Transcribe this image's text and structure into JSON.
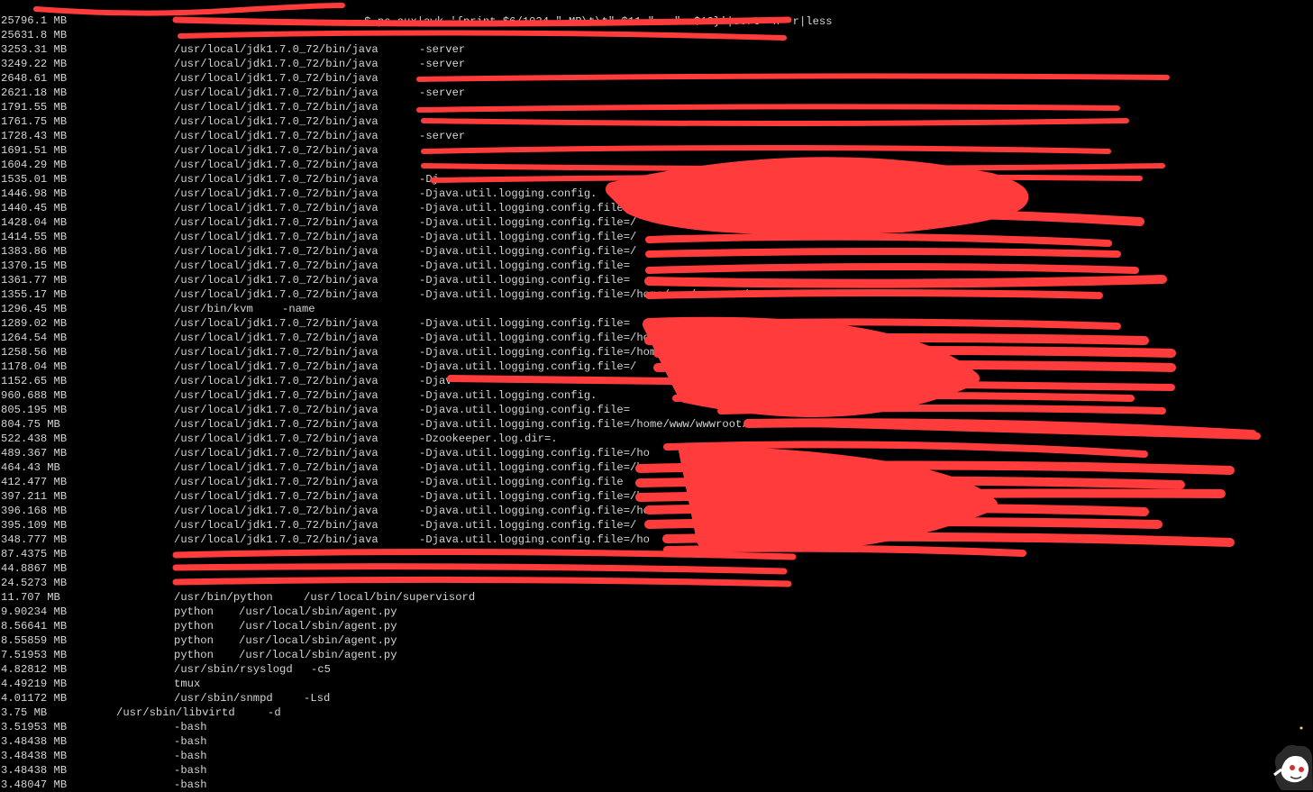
{
  "terminal": {
    "prompt_visible": "$",
    "command": " ps aux|awk '{print $6/1024 \" MB\\t\\t\" $11 \"   \"  $12}'|sort -n -r|less",
    "rows": [
      {
        "mem": "25796.1 MB",
        "bin": "",
        "arg": ""
      },
      {
        "mem": "25631.8 MB",
        "bin": "",
        "arg": ""
      },
      {
        "mem": "3253.31 MB",
        "bin": "/usr/local/jdk1.7.0_72/bin/java",
        "arg": "-server"
      },
      {
        "mem": "3249.22 MB",
        "bin": "/usr/local/jdk1.7.0_72/bin/java",
        "arg": "-server"
      },
      {
        "mem": "2648.61 MB",
        "bin": "/usr/local/jdk1.7.0_72/bin/java",
        "arg": ""
      },
      {
        "mem": "2621.18 MB",
        "bin": "/usr/local/jdk1.7.0_72/bin/java",
        "arg": "-server"
      },
      {
        "mem": "1791.55 MB",
        "bin": "/usr/local/jdk1.7.0_72/bin/java",
        "arg": ""
      },
      {
        "mem": "1761.75 MB",
        "bin": "/usr/local/jdk1.7.0_72/bin/java",
        "arg": ""
      },
      {
        "mem": "1728.43 MB",
        "bin": "/usr/local/jdk1.7.0_72/bin/java",
        "arg": "-server"
      },
      {
        "mem": "1691.51 MB",
        "bin": "/usr/local/jdk1.7.0_72/bin/java",
        "arg": ""
      },
      {
        "mem": "1604.29 MB",
        "bin": "/usr/local/jdk1.7.0_72/bin/java",
        "arg": ""
      },
      {
        "mem": "1535.01 MB",
        "bin": "/usr/local/jdk1.7.0_72/bin/java",
        "arg": "-Dj"
      },
      {
        "mem": "1446.98 MB",
        "bin": "/usr/local/jdk1.7.0_72/bin/java",
        "arg": "-Djava.util.logging.config."
      },
      {
        "mem": "1440.45 MB",
        "bin": "/usr/local/jdk1.7.0_72/bin/java",
        "arg": "-Djava.util.logging.config.file=/"
      },
      {
        "mem": "1428.04 MB",
        "bin": "/usr/local/jdk1.7.0_72/bin/java",
        "arg": "-Djava.util.logging.config.file=/"
      },
      {
        "mem": "1414.55 MB",
        "bin": "/usr/local/jdk1.7.0_72/bin/java",
        "arg": "-Djava.util.logging.config.file=/"
      },
      {
        "mem": "1383.86 MB",
        "bin": "/usr/local/jdk1.7.0_72/bin/java",
        "arg": "-Djava.util.logging.config.file=/"
      },
      {
        "mem": "1370.15 MB",
        "bin": "/usr/local/jdk1.7.0_72/bin/java",
        "arg": "-Djava.util.logging.config.file="
      },
      {
        "mem": "1361.77 MB",
        "bin": "/usr/local/jdk1.7.0_72/bin/java",
        "arg": "-Djava.util.logging.config.file="
      },
      {
        "mem": "1355.17 MB",
        "bin": "/usr/local/jdk1.7.0_72/bin/java",
        "arg": "-Djava.util.logging.config.file=/home/www/wwwroot/"
      },
      {
        "mem": "1296.45 MB",
        "bin": "/usr/bin/kvm",
        "arg": "-name",
        "short": true
      },
      {
        "mem": "1289.02 MB",
        "bin": "/usr/local/jdk1.7.0_72/bin/java",
        "arg": "-Djava.util.logging.config.file="
      },
      {
        "mem": "1264.54 MB",
        "bin": "/usr/local/jdk1.7.0_72/bin/java",
        "arg": "-Djava.util.logging.config.file=/home/"
      },
      {
        "mem": "1258.56 MB",
        "bin": "/usr/local/jdk1.7.0_72/bin/java",
        "arg": "-Djava.util.logging.config.file=/home/www"
      },
      {
        "mem": "1178.04 MB",
        "bin": "/usr/local/jdk1.7.0_72/bin/java",
        "arg": "-Djava.util.logging.config.file=/"
      },
      {
        "mem": "1152.65 MB",
        "bin": "/usr/local/jdk1.7.0_72/bin/java",
        "arg": "-Djav"
      },
      {
        "mem": "960.688 MB",
        "bin": "/usr/local/jdk1.7.0_72/bin/java",
        "arg": "-Djava.util.logging.config."
      },
      {
        "mem": "805.195 MB",
        "bin": "/usr/local/jdk1.7.0_72/bin/java",
        "arg": "-Djava.util.logging.config.file="
      },
      {
        "mem": "804.75 MB",
        "bin": "/usr/local/jdk1.7.0_72/bin/java",
        "arg": "-Djava.util.logging.config.file=/home/www/wwwroot/"
      },
      {
        "mem": "522.438 MB",
        "bin": "/usr/local/jdk1.7.0_72/bin/java",
        "arg": "-Dzookeeper.log.dir=."
      },
      {
        "mem": "489.367 MB",
        "bin": "/usr/local/jdk1.7.0_72/bin/java",
        "arg": "-Djava.util.logging.config.file=/ho"
      },
      {
        "mem": "464.43 MB",
        "bin": "/usr/local/jdk1.7.0_72/bin/java",
        "arg": "-Djava.util.logging.config.file=/h"
      },
      {
        "mem": "412.477 MB",
        "bin": "/usr/local/jdk1.7.0_72/bin/java",
        "arg": "-Djava.util.logging.config.file"
      },
      {
        "mem": "397.211 MB",
        "bin": "/usr/local/jdk1.7.0_72/bin/java",
        "arg": "-Djava.util.logging.config.file=/ho"
      },
      {
        "mem": "396.168 MB",
        "bin": "/usr/local/jdk1.7.0_72/bin/java",
        "arg": "-Djava.util.logging.config.file=/home/w"
      },
      {
        "mem": "395.109 MB",
        "bin": "/usr/local/jdk1.7.0_72/bin/java",
        "arg": "-Djava.util.logging.config.file=/"
      },
      {
        "mem": "348.777 MB",
        "bin": "/usr/local/jdk1.7.0_72/bin/java",
        "arg": "-Djava.util.logging.config.file=/ho"
      },
      {
        "mem": "87.4375 MB",
        "bin": "",
        "arg": ""
      },
      {
        "mem": "44.8867 MB",
        "bin": "",
        "arg": ""
      },
      {
        "mem": "24.5273 MB",
        "bin": "",
        "arg": ""
      },
      {
        "mem": "11.707 MB",
        "bin": "/usr/bin/python",
        "arg": "/usr/local/bin/supervisord",
        "argclass": "supervisord"
      },
      {
        "mem": "9.90234 MB",
        "bin": "python",
        "arg": "/usr/local/sbin/agent.py",
        "argclass": "agent"
      },
      {
        "mem": "8.56641 MB",
        "bin": "python",
        "arg": "/usr/local/sbin/agent.py",
        "argclass": "agent"
      },
      {
        "mem": "8.55859 MB",
        "bin": "python",
        "arg": "/usr/local/sbin/agent.py",
        "argclass": "agent"
      },
      {
        "mem": "7.51953 MB",
        "bin": "python",
        "arg": "/usr/local/sbin/agent.py",
        "argclass": "agent"
      },
      {
        "mem": "4.82812 MB",
        "bin": "/usr/sbin/rsyslogd",
        "arg": "-c5",
        "argclass": "rsyslog"
      },
      {
        "mem": "4.49219 MB",
        "bin": "tmux",
        "arg": ""
      },
      {
        "mem": "4.01172 MB",
        "bin": "/usr/sbin/snmpd",
        "arg": "-Lsd",
        "argclass": "snmpd"
      },
      {
        "mem": "3.75 MB",
        "bin": "/usr/sbin/libvirtd",
        "arg": "-d",
        "argclass": "libvirtd",
        "shift": true
      },
      {
        "mem": "3.51953 MB",
        "bin": "-bash",
        "arg": ""
      },
      {
        "mem": "3.48438 MB",
        "bin": "-bash",
        "arg": ""
      },
      {
        "mem": "3.48438 MB",
        "bin": "-bash",
        "arg": ""
      },
      {
        "mem": "3.48438 MB",
        "bin": "-bash",
        "arg": ""
      },
      {
        "mem": "3.48047 MB",
        "bin": "-bash",
        "arg": ""
      }
    ]
  },
  "colors": {
    "background": "#000000",
    "text": "#d4d4d4",
    "redaction": "#ff3b3b"
  },
  "icons": {
    "corner_mascot": "cartoon-mascot-icon"
  }
}
